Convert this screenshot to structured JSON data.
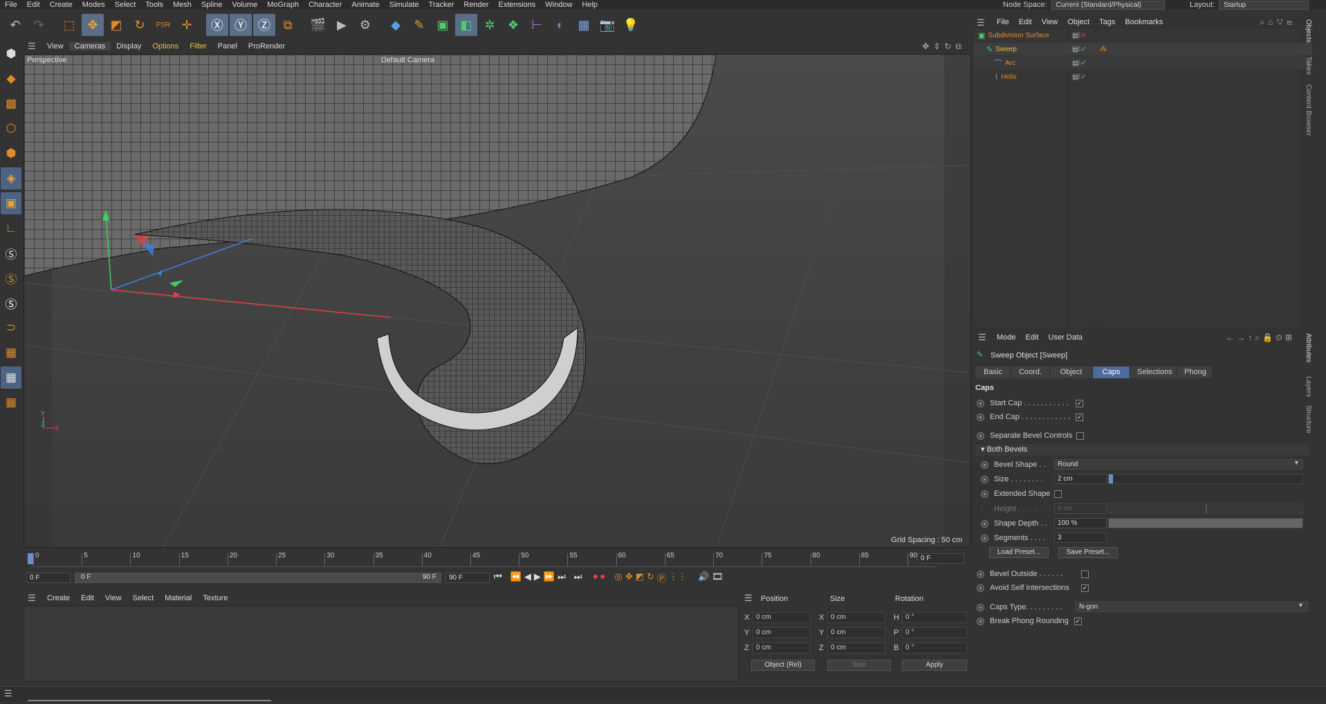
{
  "menubar": {
    "items": [
      "File",
      "Edit",
      "Create",
      "Modes",
      "Select",
      "Tools",
      "Mesh",
      "Spline",
      "Volume",
      "MoGraph",
      "Character",
      "Animate",
      "Simulate",
      "Tracker",
      "Render",
      "Extensions",
      "Window",
      "Help"
    ],
    "node_space_label": "Node Space:",
    "node_space_value": "Current (Standard/Physical)",
    "layout_label": "Layout:",
    "layout_value": "Startup"
  },
  "toolbar": {
    "icons": [
      "undo-icon",
      "redo-icon",
      "live-selection-icon",
      "move-icon",
      "scale-icon",
      "rotate-icon",
      "psr-icon",
      "add-icon",
      "x-axis-icon",
      "y-axis-icon",
      "z-axis-icon",
      "coordinate-system-icon",
      "render-view-icon",
      "render-picture-queue-icon",
      "render-settings-icon",
      "cube-primitive-icon",
      "pen-spline-icon",
      "subdivision-icon",
      "extrude-icon",
      "cloner-icon",
      "deformer-icon",
      "field-icon",
      "scene-icon",
      "floor-icon",
      "camera-icon",
      "light-icon"
    ]
  },
  "left_toolbar": {
    "icons": [
      "make-editable-icon",
      "model-mode-icon",
      "texture-mode-icon",
      "points-mode-icon",
      "edges-mode-icon",
      "polygons-mode-icon",
      "uv-mode-icon",
      "axis-mode-icon",
      "snapping-s-icon",
      "snapping-s-orange-icon",
      "snapping-s-white-icon",
      "magnet-icon",
      "workplane-icon",
      "lock-grid-icon",
      "lock-workplane-icon"
    ]
  },
  "viewport_menu": {
    "items": [
      "View",
      "Cameras",
      "Display",
      "Options",
      "Filter",
      "Panel",
      "ProRender"
    ]
  },
  "viewport": {
    "projection": "Perspective",
    "camera": "Default Camera",
    "grid_spacing": "Grid Spacing : 50 cm",
    "axis_y": "Y",
    "axis_z": "Z",
    "axis_x": "X"
  },
  "timeline": {
    "ticks": [
      "0",
      "5",
      "10",
      "15",
      "20",
      "25",
      "30",
      "35",
      "40",
      "45",
      "50",
      "55",
      "60",
      "65",
      "70",
      "75",
      "80",
      "85",
      "90"
    ],
    "current_frame": "0 F"
  },
  "playbar": {
    "start": "0 F",
    "range_start": "0 F",
    "range_end": "90 F",
    "end": "90 F"
  },
  "material_menu": {
    "items": [
      "Create",
      "Edit",
      "View",
      "Select",
      "Material",
      "Texture"
    ]
  },
  "coordinates": {
    "headers": [
      "Position",
      "Size",
      "Rotation"
    ],
    "rows": [
      {
        "pos_axis": "X",
        "pos": "0 cm",
        "size_axis": "X",
        "size": "0 cm",
        "rot_axis": "H",
        "rot": "0 °"
      },
      {
        "pos_axis": "Y",
        "pos": "0 cm",
        "size_axis": "Y",
        "size": "0 cm",
        "rot_axis": "P",
        "rot": "0 °"
      },
      {
        "pos_axis": "Z",
        "pos": "0 cm",
        "size_axis": "Z",
        "size": "0 cm",
        "rot_axis": "B",
        "rot": "0 °"
      }
    ],
    "mode_value": "Object (Rel)",
    "size_mode": "Size",
    "apply": "Apply"
  },
  "objects_panel": {
    "menu": [
      "File",
      "Edit",
      "View",
      "Object",
      "Tags",
      "Bookmarks"
    ],
    "items": [
      {
        "name": "Subdivision Surface",
        "color": "#e08a2a",
        "indent": 0
      },
      {
        "name": "Sweep",
        "color": "#e8c23a",
        "indent": 1
      },
      {
        "name": "Arc",
        "color": "#e08a2a",
        "indent": 2
      },
      {
        "name": "Helix",
        "color": "#e08a2a",
        "indent": 2
      }
    ],
    "side_tabs": [
      "Objects",
      "Takes",
      "Content Browser"
    ]
  },
  "attributes_panel": {
    "menu": [
      "Mode",
      "Edit",
      "User Data"
    ],
    "object_title": "Sweep Object [Sweep]",
    "tabs": [
      "Basic",
      "Coord.",
      "Object",
      "Caps",
      "Selections",
      "Phong"
    ],
    "active_tab": "Caps",
    "section": "Caps",
    "start_cap": "Start Cap . . . . . . . . . . .",
    "end_cap": "End Cap . . . . . . . . . . . .",
    "separate_bevel": "Separate Bevel Controls",
    "both_bevels": "Both Bevels",
    "bevel_shape_label": "Bevel Shape . .",
    "bevel_shape_value": "Round",
    "size_label": "Size . . . . . . . .",
    "size_value": "2 cm",
    "size_fraction": 0.02,
    "extended_shape": "Extended Shape",
    "height_label": "Height . . . . . .",
    "height_value": "0 cm",
    "shape_depth_label": "Shape Depth . .",
    "shape_depth_value": "100 %",
    "shape_depth_fraction": 1.0,
    "segments_label": "Segments . . . .",
    "segments_value": "3",
    "load_preset": "Load Preset...",
    "save_preset": "Save Preset...",
    "bevel_outside": "Bevel Outside . . . . . .",
    "avoid_self": "Avoid Self Intersections",
    "caps_type_label": "Caps Type. . . . . . . . .",
    "caps_type_value": "N-gon",
    "break_phong": "Break Phong Rounding",
    "side_tabs": [
      "Attributes",
      "Layers",
      "Structure"
    ]
  },
  "colors": {
    "accent": "#4f6b9c",
    "selected_object": "#e08a2a"
  }
}
